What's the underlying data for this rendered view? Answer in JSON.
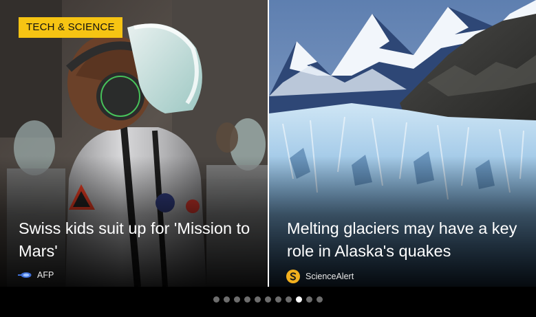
{
  "cards": [
    {
      "category": "TECH & SCIENCE",
      "headline": "Swiss kids suit up for 'Mission to Mars'",
      "source": "AFP"
    },
    {
      "headline": "Melting glaciers may have a key role in Alaska's quakes",
      "source": "ScienceAlert"
    }
  ],
  "pager": {
    "total": 11,
    "active_index": 8
  },
  "colors": {
    "badge": "#f6c413",
    "dot_inactive": "#6d6d6d",
    "dot_active": "#ffffff"
  }
}
